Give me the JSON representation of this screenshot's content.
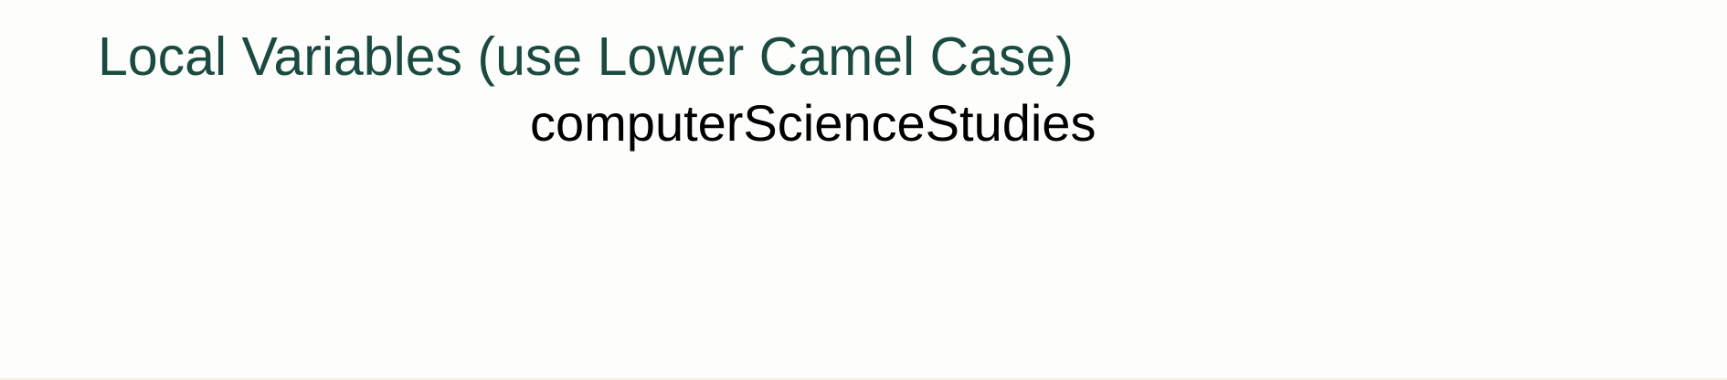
{
  "slide": {
    "title": "Local Variables (use Lower Camel Case)",
    "example": "computerScienceStudies"
  },
  "colors": {
    "background": "#fdfdfb",
    "title": "#1a4a40",
    "example_text": "#000000"
  }
}
